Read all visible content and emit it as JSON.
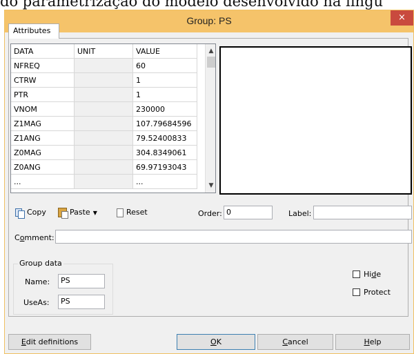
{
  "background_caption": "do parametrização do modelo desenvolvido na lingu",
  "window": {
    "title": "Group: PS",
    "close_glyph": "×"
  },
  "tabs": [
    {
      "label": "Attributes",
      "selected": true
    }
  ],
  "grid": {
    "columns": [
      "DATA",
      "UNIT",
      "VALUE"
    ],
    "rows": [
      {
        "data": "NFREQ",
        "unit": "",
        "value": "60"
      },
      {
        "data": "CTRW",
        "unit": "",
        "value": "1"
      },
      {
        "data": "PTR",
        "unit": "",
        "value": "1"
      },
      {
        "data": "VNOM",
        "unit": "",
        "value": "230000"
      },
      {
        "data": "Z1MAG",
        "unit": "",
        "value": "107.79684596"
      },
      {
        "data": "Z1ANG",
        "unit": "",
        "value": "79.52400833"
      },
      {
        "data": "Z0MAG",
        "unit": "",
        "value": "304.8349061"
      },
      {
        "data": "Z0ANG",
        "unit": "",
        "value": "69.97193043"
      },
      {
        "data": "...",
        "unit": "",
        "value": "..."
      }
    ],
    "scroll_up_glyph": "▲",
    "scroll_down_glyph": "▼"
  },
  "toolbar": {
    "copy_label": "Copy",
    "paste_label": "Paste",
    "paste_caret": "▼",
    "reset_label": "Reset",
    "copy_icon": "copy-icon",
    "paste_icon": "clipboard-icon",
    "reset_icon": "document-icon"
  },
  "order": {
    "label": "Order:",
    "value": "0"
  },
  "label_field": {
    "label": "Label:",
    "value": ""
  },
  "comment": {
    "label_prefix": "C",
    "label_underlined": "o",
    "label_suffix": "mment:",
    "value": ""
  },
  "group_data": {
    "legend": "Group data",
    "name_label": "Name:",
    "name_value": "PS",
    "useas_label": "UseAs:",
    "useas_value": "PS"
  },
  "options": {
    "hide": {
      "label_prefix": "Hi",
      "label_underlined": "d",
      "label_suffix": "e",
      "checked": false
    },
    "protect": {
      "label": "Protect",
      "checked": false
    }
  },
  "buttons": {
    "edit_definitions": {
      "underlined": "E",
      "rest": "dit definitions"
    },
    "ok": {
      "underlined": "O",
      "rest": "K"
    },
    "cancel": {
      "underlined": "C",
      "rest": "ancel"
    },
    "help": {
      "underlined": "H",
      "rest": "elp"
    }
  },
  "colors": {
    "titlebar": "#f5c36a",
    "close_button": "#c94a3e",
    "dialog_bg": "#f0f0f0"
  }
}
